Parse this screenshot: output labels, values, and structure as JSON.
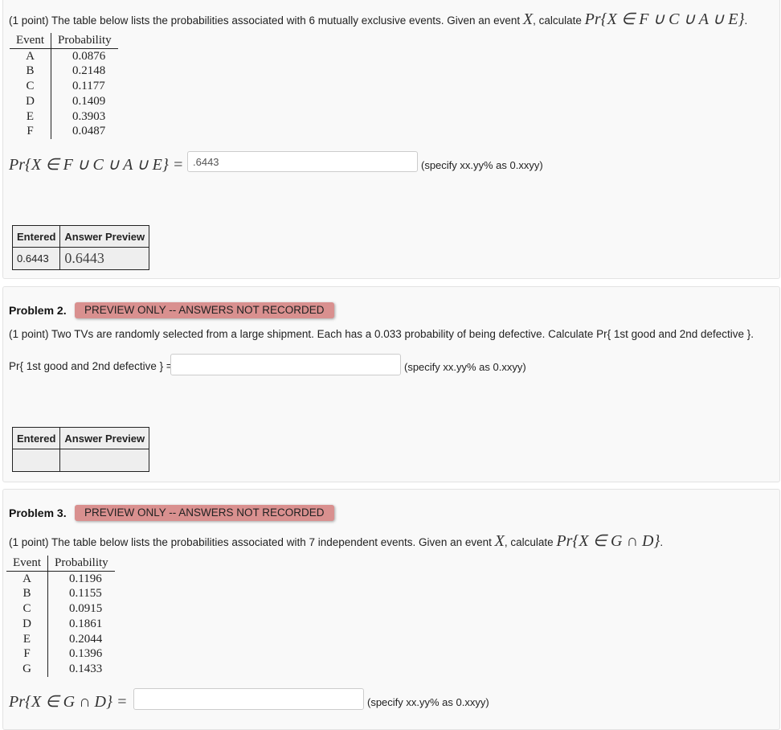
{
  "problems": [
    {
      "intro": "(1 point) The table below lists the probabilities associated with 6 mutually exclusive events. Given an event",
      "intro_var": "X",
      "intro_calc": ", calculate",
      "expression": "Pr{X ∈ F ∪ C ∪ A ∪ E}",
      "table": {
        "headers": [
          "Event",
          "Probability"
        ],
        "rows": [
          [
            "A",
            "0.0876"
          ],
          [
            "B",
            "0.2148"
          ],
          [
            "C",
            "0.1177"
          ],
          [
            "D",
            "0.1409"
          ],
          [
            "E",
            "0.3903"
          ],
          [
            "F",
            "0.0487"
          ]
        ]
      },
      "answer_label": "Pr{X ∈ F ∪ C ∪ A ∪ E} =",
      "answer_value": ".6443",
      "hint": "(specify xx.yy% as 0.xxyy)",
      "results": {
        "headers": [
          "Entered",
          "Answer Preview"
        ],
        "entered": "0.6443",
        "preview": "0.6443"
      }
    },
    {
      "title": "Problem 2.",
      "badge": "PREVIEW ONLY -- ANSWERS NOT RECORDED",
      "intro": "(1 point) Two TVs are randomly selected from a large shipment. Each has a 0.033 probability of being defective. Calculate Pr{ 1st good and 2nd defective }.",
      "answer_label": "Pr{ 1st good and 2nd defective } =",
      "answer_value": "",
      "hint": "(specify xx.yy% as 0.xxyy)",
      "results": {
        "headers": [
          "Entered",
          "Answer Preview"
        ],
        "entered": "",
        "preview": ""
      }
    },
    {
      "title": "Problem 3.",
      "badge": "PREVIEW ONLY -- ANSWERS NOT RECORDED",
      "intro": "(1 point) The table below lists the probabilities associated with 7 independent events. Given an event",
      "intro_var": "X",
      "intro_calc": ", calculate",
      "expression": "Pr{X ∈ G ∩ D}",
      "table": {
        "headers": [
          "Event",
          "Probability"
        ],
        "rows": [
          [
            "A",
            "0.1196"
          ],
          [
            "B",
            "0.1155"
          ],
          [
            "C",
            "0.0915"
          ],
          [
            "D",
            "0.1861"
          ],
          [
            "E",
            "0.2044"
          ],
          [
            "F",
            "0.1396"
          ],
          [
            "G",
            "0.1433"
          ]
        ]
      },
      "answer_label": "Pr{X ∈ G ∩ D} =",
      "answer_value": "",
      "hint": "(specify xx.yy% as 0.xxyy)"
    }
  ],
  "colors": {
    "badge_bg": "#d9908f",
    "panel_bg": "#f9f9f9",
    "results_bg": "#eeeeee"
  }
}
